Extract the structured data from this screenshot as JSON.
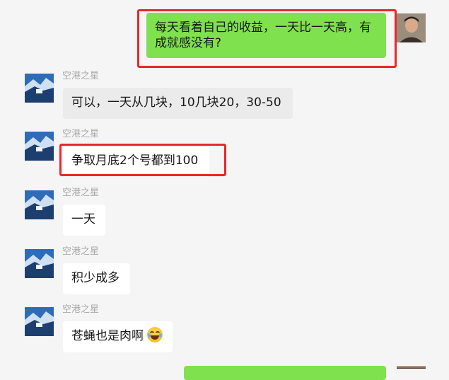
{
  "messages": [
    {
      "sender": "",
      "text": "每天看着自己的收益，一天比一天高，有成就感没有?",
      "line1": "每天看着自己的收益，一天比一天高，有",
      "line2": "成就感没有?"
    },
    {
      "sender": "空港之星",
      "text": "可以，一天从几块，10几块20，30-50"
    },
    {
      "sender": "空港之星",
      "text": "争取月底2个号都到100"
    },
    {
      "sender": "空港之星",
      "text": "一天"
    },
    {
      "sender": "空港之星",
      "text": "积少成多"
    },
    {
      "sender": "空港之星",
      "text": "苍蝇也是肉啊",
      "emoji": "tears-of-joy-emoji"
    }
  ],
  "colors": {
    "background": "#f5f5f5",
    "outgoing_bubble": "#80e14f",
    "incoming_bubble": "#ffffff",
    "highlight_border": "#e8282b",
    "sender_name": "#a8a8a8"
  },
  "icons": {
    "self_avatar": "user-photo-avatar",
    "contact_avatar": "landscape-avatar"
  }
}
